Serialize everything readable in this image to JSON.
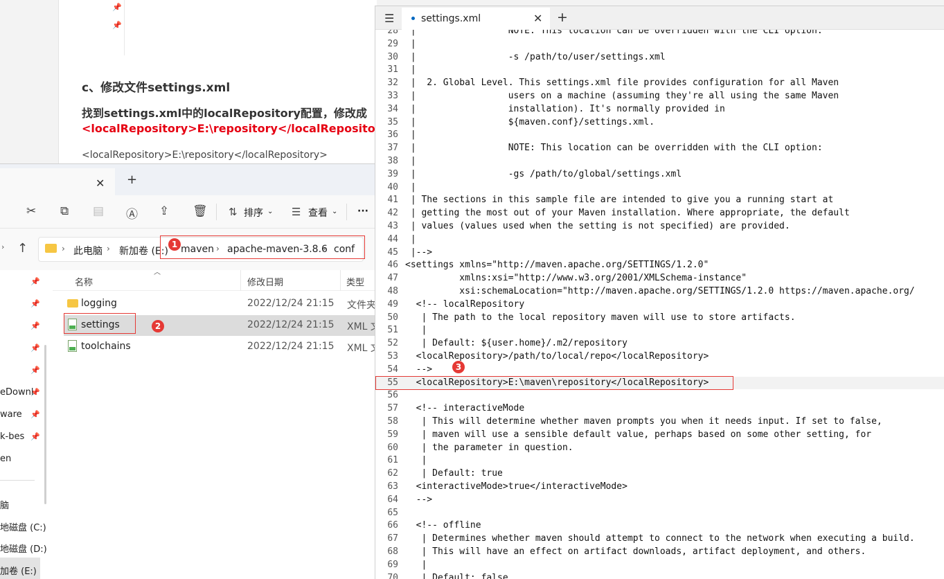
{
  "doc": {
    "heading": "c、修改文件settings.xml",
    "instruction": "找到settings.xml中的localRepository配置，修改成",
    "red_code": "<localRepository>E:\\repository</localReposito",
    "code_line": "<localRepository>E:\\repository</localRepository>"
  },
  "explorer": {
    "close_glyph": "✕",
    "newtab_glyph": "+",
    "toolbar": {
      "sort_label": "排序",
      "view_label": "查看",
      "more_label": "···"
    },
    "breadcrumbs": [
      "此电脑",
      "新加卷 (E:)",
      "maven",
      "apache-maven-3.8.6",
      "conf"
    ],
    "columns": {
      "name": "名称",
      "date": "修改日期",
      "type": "类型"
    },
    "files": [
      {
        "name": "logging",
        "date": "2022/12/24 21:15",
        "type": "文件夹",
        "icon": "folder-icon"
      },
      {
        "name": "settings",
        "date": "2022/12/24 21:15",
        "type": "XML 文",
        "icon": "xml-file-icon"
      },
      {
        "name": "toolchains",
        "date": "2022/12/24 21:15",
        "type": "XML 文",
        "icon": "xml-file-icon"
      }
    ],
    "nav": [
      "eDownl",
      "ware",
      "k-bes",
      "en",
      "脑",
      "地磁盘 (C:)",
      "地磁盘 (D:)",
      "加卷 (E:)"
    ],
    "badges": [
      "1",
      "2",
      "3"
    ]
  },
  "editor": {
    "menu_glyph": "☰",
    "tab_name": "settings.xml",
    "close_glyph": "✕",
    "newtab_glyph": "+",
    "lines": [
      {
        "n": "28",
        "t": " |                 NOTE: This location can be overridden with the CLI option:"
      },
      {
        "n": "29",
        "t": " |"
      },
      {
        "n": "30",
        "t": " |                 -s /path/to/user/settings.xml"
      },
      {
        "n": "31",
        "t": " |"
      },
      {
        "n": "32",
        "t": " |  2. Global Level. This settings.xml file provides configuration for all Maven"
      },
      {
        "n": "33",
        "t": " |                 users on a machine (assuming they're all using the same Maven"
      },
      {
        "n": "34",
        "t": " |                 installation). It's normally provided in"
      },
      {
        "n": "35",
        "t": " |                 ${maven.conf}/settings.xml."
      },
      {
        "n": "36",
        "t": " |"
      },
      {
        "n": "37",
        "t": " |                 NOTE: This location can be overridden with the CLI option:"
      },
      {
        "n": "38",
        "t": " |"
      },
      {
        "n": "39",
        "t": " |                 -gs /path/to/global/settings.xml"
      },
      {
        "n": "40",
        "t": " |"
      },
      {
        "n": "41",
        "t": " | The sections in this sample file are intended to give you a running start at"
      },
      {
        "n": "42",
        "t": " | getting the most out of your Maven installation. Where appropriate, the default"
      },
      {
        "n": "43",
        "t": " | values (values used when the setting is not specified) are provided."
      },
      {
        "n": "44",
        "t": " |"
      },
      {
        "n": "45",
        "t": " |-->"
      },
      {
        "n": "46",
        "t": "<settings xmlns=\"http://maven.apache.org/SETTINGS/1.2.0\""
      },
      {
        "n": "47",
        "t": "          xmlns:xsi=\"http://www.w3.org/2001/XMLSchema-instance\""
      },
      {
        "n": "48",
        "t": "          xsi:schemaLocation=\"http://maven.apache.org/SETTINGS/1.2.0 https://maven.apache.org/"
      },
      {
        "n": "49",
        "t": "  <!-- localRepository"
      },
      {
        "n": "50",
        "t": "   | The path to the local repository maven will use to store artifacts."
      },
      {
        "n": "51",
        "t": "   |"
      },
      {
        "n": "52",
        "t": "   | Default: ${user.home}/.m2/repository"
      },
      {
        "n": "53",
        "t": "  <localRepository>/path/to/local/repo</localRepository>"
      },
      {
        "n": "54",
        "t": "  -->"
      },
      {
        "n": "55",
        "t": "  <localRepository>E:\\maven\\repository</localRepository>"
      },
      {
        "n": "56",
        "t": ""
      },
      {
        "n": "57",
        "t": "  <!-- interactiveMode"
      },
      {
        "n": "58",
        "t": "   | This will determine whether maven prompts you when it needs input. If set to false,"
      },
      {
        "n": "59",
        "t": "   | maven will use a sensible default value, perhaps based on some other setting, for"
      },
      {
        "n": "60",
        "t": "   | the parameter in question."
      },
      {
        "n": "61",
        "t": "   |"
      },
      {
        "n": "62",
        "t": "   | Default: true"
      },
      {
        "n": "63",
        "t": "  <interactiveMode>true</interactiveMode>"
      },
      {
        "n": "64",
        "t": "  -->"
      },
      {
        "n": "65",
        "t": ""
      },
      {
        "n": "66",
        "t": "  <!-- offline"
      },
      {
        "n": "67",
        "t": "   | Determines whether maven should attempt to connect to the network when executing a build."
      },
      {
        "n": "68",
        "t": "   | This will have an effect on artifact downloads, artifact deployment, and others."
      },
      {
        "n": "69",
        "t": "   |"
      },
      {
        "n": "70",
        "t": "   | Default: false"
      }
    ]
  },
  "colors": {
    "annotation_red": "#e53935",
    "doc_red": "#e60012",
    "accent": "#0067c0"
  }
}
